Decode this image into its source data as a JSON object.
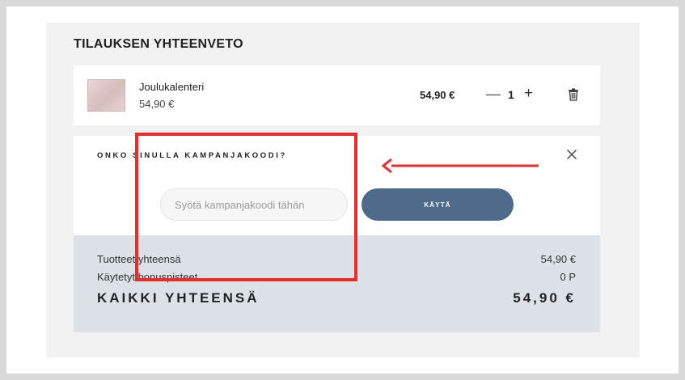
{
  "summary": {
    "title": "TILAUKSEN YHTEENVETO"
  },
  "item": {
    "name": "Joulukalenteri",
    "unit_price": "54,90 €",
    "line_total": "54,90 €",
    "qty_minus": "—",
    "quantity": "1",
    "qty_plus": "+",
    "thumbnail_icon": "product-thumbnail",
    "delete_icon": "trash-icon"
  },
  "promo": {
    "question": "ONKO SINULLA KAMPANJAKOODI?",
    "placeholder": "Syötä kampanjakoodi tähän",
    "apply_label": "KÄYTÄ",
    "close_icon": "close-icon"
  },
  "totals": {
    "products_label": "Tuotteet yhteensä",
    "products_value": "54,90 €",
    "bonus_label": "Käytetyt bonuspisteet",
    "bonus_value": "0 P",
    "grand_label": "KAIKKI YHTEENSÄ",
    "grand_value": "54,90 €"
  },
  "colors": {
    "accent_button": "#4e6b8c",
    "annotation_red": "#ee2b2b",
    "totals_bg": "#dde2e8"
  }
}
